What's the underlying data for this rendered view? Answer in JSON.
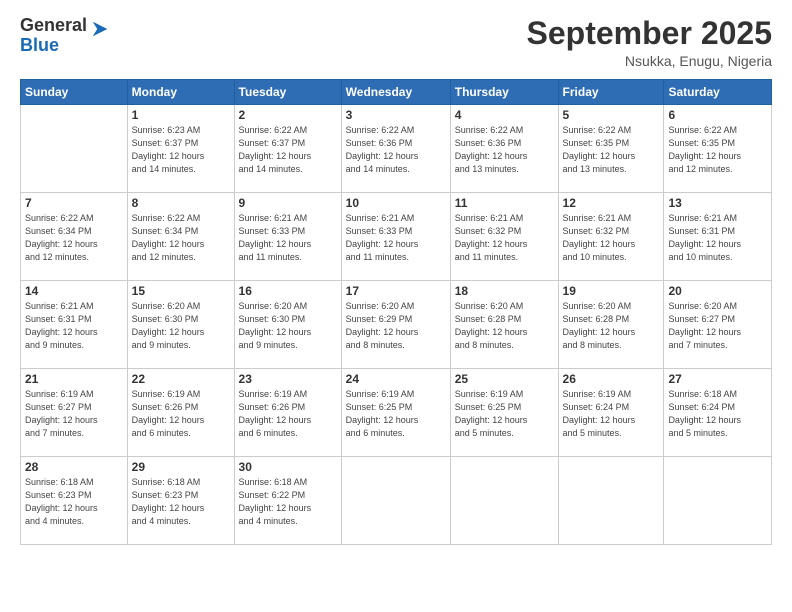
{
  "header": {
    "logo_general": "General",
    "logo_blue": "Blue",
    "month_title": "September 2025",
    "location": "Nsukka, Enugu, Nigeria"
  },
  "weekdays": [
    "Sunday",
    "Monday",
    "Tuesday",
    "Wednesday",
    "Thursday",
    "Friday",
    "Saturday"
  ],
  "weeks": [
    [
      {
        "num": "",
        "info": ""
      },
      {
        "num": "1",
        "info": "Sunrise: 6:23 AM\nSunset: 6:37 PM\nDaylight: 12 hours\nand 14 minutes."
      },
      {
        "num": "2",
        "info": "Sunrise: 6:22 AM\nSunset: 6:37 PM\nDaylight: 12 hours\nand 14 minutes."
      },
      {
        "num": "3",
        "info": "Sunrise: 6:22 AM\nSunset: 6:36 PM\nDaylight: 12 hours\nand 14 minutes."
      },
      {
        "num": "4",
        "info": "Sunrise: 6:22 AM\nSunset: 6:36 PM\nDaylight: 12 hours\nand 13 minutes."
      },
      {
        "num": "5",
        "info": "Sunrise: 6:22 AM\nSunset: 6:35 PM\nDaylight: 12 hours\nand 13 minutes."
      },
      {
        "num": "6",
        "info": "Sunrise: 6:22 AM\nSunset: 6:35 PM\nDaylight: 12 hours\nand 12 minutes."
      }
    ],
    [
      {
        "num": "7",
        "info": "Sunrise: 6:22 AM\nSunset: 6:34 PM\nDaylight: 12 hours\nand 12 minutes."
      },
      {
        "num": "8",
        "info": "Sunrise: 6:22 AM\nSunset: 6:34 PM\nDaylight: 12 hours\nand 12 minutes."
      },
      {
        "num": "9",
        "info": "Sunrise: 6:21 AM\nSunset: 6:33 PM\nDaylight: 12 hours\nand 11 minutes."
      },
      {
        "num": "10",
        "info": "Sunrise: 6:21 AM\nSunset: 6:33 PM\nDaylight: 12 hours\nand 11 minutes."
      },
      {
        "num": "11",
        "info": "Sunrise: 6:21 AM\nSunset: 6:32 PM\nDaylight: 12 hours\nand 11 minutes."
      },
      {
        "num": "12",
        "info": "Sunrise: 6:21 AM\nSunset: 6:32 PM\nDaylight: 12 hours\nand 10 minutes."
      },
      {
        "num": "13",
        "info": "Sunrise: 6:21 AM\nSunset: 6:31 PM\nDaylight: 12 hours\nand 10 minutes."
      }
    ],
    [
      {
        "num": "14",
        "info": "Sunrise: 6:21 AM\nSunset: 6:31 PM\nDaylight: 12 hours\nand 9 minutes."
      },
      {
        "num": "15",
        "info": "Sunrise: 6:20 AM\nSunset: 6:30 PM\nDaylight: 12 hours\nand 9 minutes."
      },
      {
        "num": "16",
        "info": "Sunrise: 6:20 AM\nSunset: 6:30 PM\nDaylight: 12 hours\nand 9 minutes."
      },
      {
        "num": "17",
        "info": "Sunrise: 6:20 AM\nSunset: 6:29 PM\nDaylight: 12 hours\nand 8 minutes."
      },
      {
        "num": "18",
        "info": "Sunrise: 6:20 AM\nSunset: 6:28 PM\nDaylight: 12 hours\nand 8 minutes."
      },
      {
        "num": "19",
        "info": "Sunrise: 6:20 AM\nSunset: 6:28 PM\nDaylight: 12 hours\nand 8 minutes."
      },
      {
        "num": "20",
        "info": "Sunrise: 6:20 AM\nSunset: 6:27 PM\nDaylight: 12 hours\nand 7 minutes."
      }
    ],
    [
      {
        "num": "21",
        "info": "Sunrise: 6:19 AM\nSunset: 6:27 PM\nDaylight: 12 hours\nand 7 minutes."
      },
      {
        "num": "22",
        "info": "Sunrise: 6:19 AM\nSunset: 6:26 PM\nDaylight: 12 hours\nand 6 minutes."
      },
      {
        "num": "23",
        "info": "Sunrise: 6:19 AM\nSunset: 6:26 PM\nDaylight: 12 hours\nand 6 minutes."
      },
      {
        "num": "24",
        "info": "Sunrise: 6:19 AM\nSunset: 6:25 PM\nDaylight: 12 hours\nand 6 minutes."
      },
      {
        "num": "25",
        "info": "Sunrise: 6:19 AM\nSunset: 6:25 PM\nDaylight: 12 hours\nand 5 minutes."
      },
      {
        "num": "26",
        "info": "Sunrise: 6:19 AM\nSunset: 6:24 PM\nDaylight: 12 hours\nand 5 minutes."
      },
      {
        "num": "27",
        "info": "Sunrise: 6:18 AM\nSunset: 6:24 PM\nDaylight: 12 hours\nand 5 minutes."
      }
    ],
    [
      {
        "num": "28",
        "info": "Sunrise: 6:18 AM\nSunset: 6:23 PM\nDaylight: 12 hours\nand 4 minutes."
      },
      {
        "num": "29",
        "info": "Sunrise: 6:18 AM\nSunset: 6:23 PM\nDaylight: 12 hours\nand 4 minutes."
      },
      {
        "num": "30",
        "info": "Sunrise: 6:18 AM\nSunset: 6:22 PM\nDaylight: 12 hours\nand 4 minutes."
      },
      {
        "num": "",
        "info": ""
      },
      {
        "num": "",
        "info": ""
      },
      {
        "num": "",
        "info": ""
      },
      {
        "num": "",
        "info": ""
      }
    ]
  ]
}
